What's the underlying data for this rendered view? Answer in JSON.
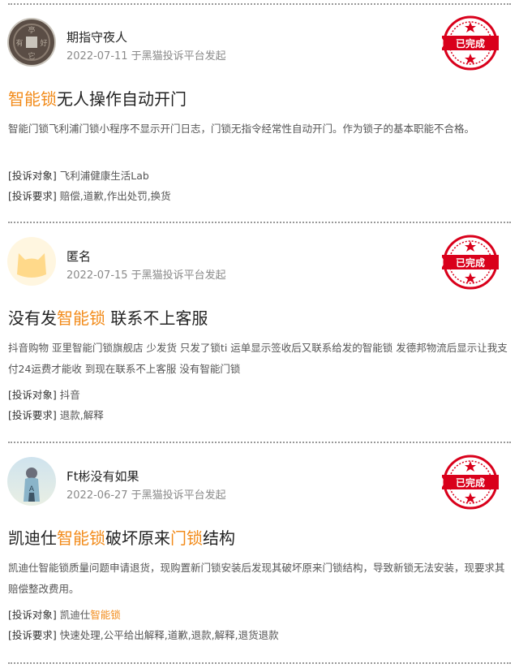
{
  "complaints": [
    {
      "author": "期指守夜人",
      "meta": "2022-07-11 于黑猫投诉平台发起",
      "status": "已完成",
      "title": {
        "hl": "智能锁",
        "rest": "无人操作自动开门"
      },
      "description": "智能门锁飞利浦门锁小程序不显示开门日志，门锁无指令经常性自动开门。作为锁子的基本职能不合格。",
      "target_label": "[投诉对象]",
      "target_value": "飞利浦健康生活Lab",
      "demand_label": "[投诉要求]",
      "demand_value": "赔偿,道歉,作出处罚,换货",
      "avatar_icon": "ancient-coin-avatar"
    },
    {
      "author": "匿名",
      "meta": "2022-07-15 于黑猫投诉平台发起",
      "status": "已完成",
      "title": {
        "pre": "没有发",
        "hl": "智能锁",
        "post": " 联系不上客服"
      },
      "description": "抖音购物 亚里智能门锁旗舰店 少发货 只发了锁ti 运单显示签收后又联系给发的智能锁 发德邦物流后显示让我支付24运费才能收 到现在联系不上客服 没有智能门锁",
      "target_label": "[投诉对象]",
      "target_value": "抖音",
      "demand_label": "[投诉要求]",
      "demand_value": "退款,解释",
      "avatar_icon": "cat-face-avatar"
    },
    {
      "author": "Ft彬没有如果",
      "meta": "2022-06-27 于黑猫投诉平台发起",
      "status": "已完成",
      "title": {
        "pre": "凯迪仕",
        "hl": "智能锁",
        "mid": "破坏原来",
        "hl2": "门锁",
        "post": "结构"
      },
      "description": "凯迪仕智能锁质量问题申请退货，现购置新门锁安装后发现其破坏原来门锁结构，导致新锁无法安装，现要求其赔偿整改费用。",
      "target_label": "[投诉对象]",
      "target_value_pre": "凯迪仕",
      "target_value_hl": "智能锁",
      "demand_label": "[投诉要求]",
      "demand_value": "快速处理,公平给出解释,道歉,退款,解释,退货退款",
      "avatar_icon": "person-photo-avatar"
    }
  ],
  "colors": {
    "highlight": "#f28b1a",
    "stamp": "#d9001b"
  }
}
